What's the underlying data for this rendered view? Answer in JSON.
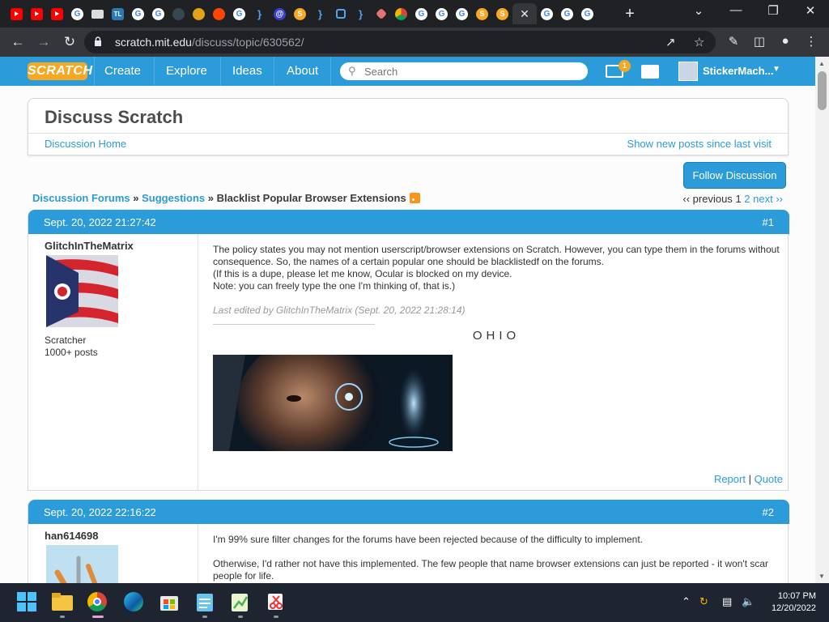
{
  "browser": {
    "url_host": "scratch.mit.edu",
    "url_path": "/discuss/topic/630562/",
    "tabs": [
      "youtube",
      "youtube",
      "youtube",
      "google",
      "monitor",
      "tl",
      "google",
      "google",
      "wifi",
      "bag",
      "reddit",
      "google",
      "brace",
      "at",
      "scratch",
      "brace",
      "square",
      "brace",
      "diamond",
      "chrome",
      "google",
      "google",
      "google",
      "scratch",
      "scratch",
      "close",
      "google",
      "google",
      "google"
    ]
  },
  "nav": {
    "logo": "SCRATCH",
    "links": [
      "Create",
      "Explore",
      "Ideas",
      "About"
    ],
    "search_placeholder": "Search",
    "message_count": "1",
    "username": "StickerMach..."
  },
  "page": {
    "title": "Discuss Scratch",
    "home_link": "Discussion Home",
    "new_posts_link": "Show new posts since last visit",
    "follow_button": "Follow Discussion",
    "breadcrumb": {
      "forums": "Discussion Forums",
      "sep1": " » ",
      "category": "Suggestions",
      "sep2": " » ",
      "topic": "Blacklist Popular Browser Extensions"
    },
    "pagination": {
      "prev": "‹‹ previous",
      "current": "1",
      "page2": "2",
      "next": "next ››"
    }
  },
  "posts": [
    {
      "date": "Sept. 20, 2022 21:27:42",
      "number": "#1",
      "author": "GlitchInTheMatrix",
      "rank": "Scratcher",
      "post_count": "1000+ posts",
      "lines": [
        "The policy states you may not mention userscript/browser extensions on Scratch. However, you can type them in the forums without consequence. So, the names of a certain popular one should be blacklistedf on the forums.",
        "(If this is a dupe, please let me know, Ocular is blocked on my device.",
        "Note: you can freely type the one I'm thinking of, that is.)"
      ],
      "edited": "Last edited by GlitchInTheMatrix (Sept. 20, 2022 21:28:14)",
      "signature": "OHIO",
      "report": "Report",
      "quote": "Quote"
    },
    {
      "date": "Sept. 20, 2022 22:16:22",
      "number": "#2",
      "author": "han614698",
      "lines": [
        "I'm 99% sure filter changes for the forums have been rejected because of the difficulty to implement.",
        "Otherwise, I'd rather not have this implemented. The few people that name browser extensions can just be reported - it won't scar people for life."
      ]
    }
  ],
  "taskbar": {
    "time": "10:07 PM",
    "date": "12/20/2022"
  }
}
